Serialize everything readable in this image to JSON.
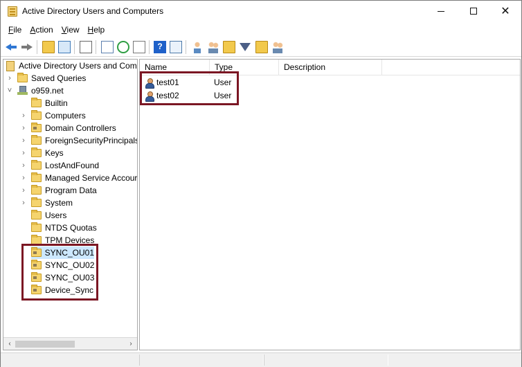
{
  "window": {
    "title": "Active Directory Users and Computers",
    "minimize_label": "—",
    "maximize_label": "☐",
    "close_label": "✕"
  },
  "menu": {
    "items": [
      {
        "label": "File",
        "mnemonic": "F"
      },
      {
        "label": "Action",
        "mnemonic": "A"
      },
      {
        "label": "View",
        "mnemonic": "V"
      },
      {
        "label": "Help",
        "mnemonic": "H"
      }
    ]
  },
  "toolbar": {
    "help_glyph": "?"
  },
  "tree": {
    "items": [
      {
        "label": "Active Directory Users and Com",
        "type": "root"
      },
      {
        "label": "Saved Queries",
        "type": "folder",
        "expander": "›"
      },
      {
        "label": "o959.net",
        "type": "domain",
        "expander": "˅"
      },
      {
        "label": "Builtin",
        "type": "folder"
      },
      {
        "label": "Computers",
        "type": "folder",
        "expander": "›"
      },
      {
        "label": "Domain Controllers",
        "type": "ou",
        "expander": "›"
      },
      {
        "label": "ForeignSecurityPrincipals",
        "type": "folder",
        "expander": "›"
      },
      {
        "label": "Keys",
        "type": "folder",
        "expander": "›"
      },
      {
        "label": "LostAndFound",
        "type": "folder",
        "expander": "›"
      },
      {
        "label": "Managed Service Accour",
        "type": "folder",
        "expander": "›"
      },
      {
        "label": "Program Data",
        "type": "folder",
        "expander": "›"
      },
      {
        "label": "System",
        "type": "folder",
        "expander": "›"
      },
      {
        "label": "Users",
        "type": "folder"
      },
      {
        "label": "NTDS Quotas",
        "type": "folder"
      },
      {
        "label": "TPM Devices",
        "type": "folder"
      },
      {
        "label": "SYNC_OU01",
        "type": "ou",
        "selected": true
      },
      {
        "label": "SYNC_OU02",
        "type": "ou"
      },
      {
        "label": "SYNC_OU03",
        "type": "ou"
      },
      {
        "label": "Device_Sync",
        "type": "ou"
      }
    ]
  },
  "list": {
    "columns": [
      {
        "label": "Name"
      },
      {
        "label": "Type"
      },
      {
        "label": "Description"
      }
    ],
    "rows": [
      {
        "name": "test01",
        "type": "User",
        "description": ""
      },
      {
        "name": "test02",
        "type": "User",
        "description": ""
      }
    ]
  },
  "scrollbar": {
    "left_arrow": "‹",
    "right_arrow": "›"
  }
}
